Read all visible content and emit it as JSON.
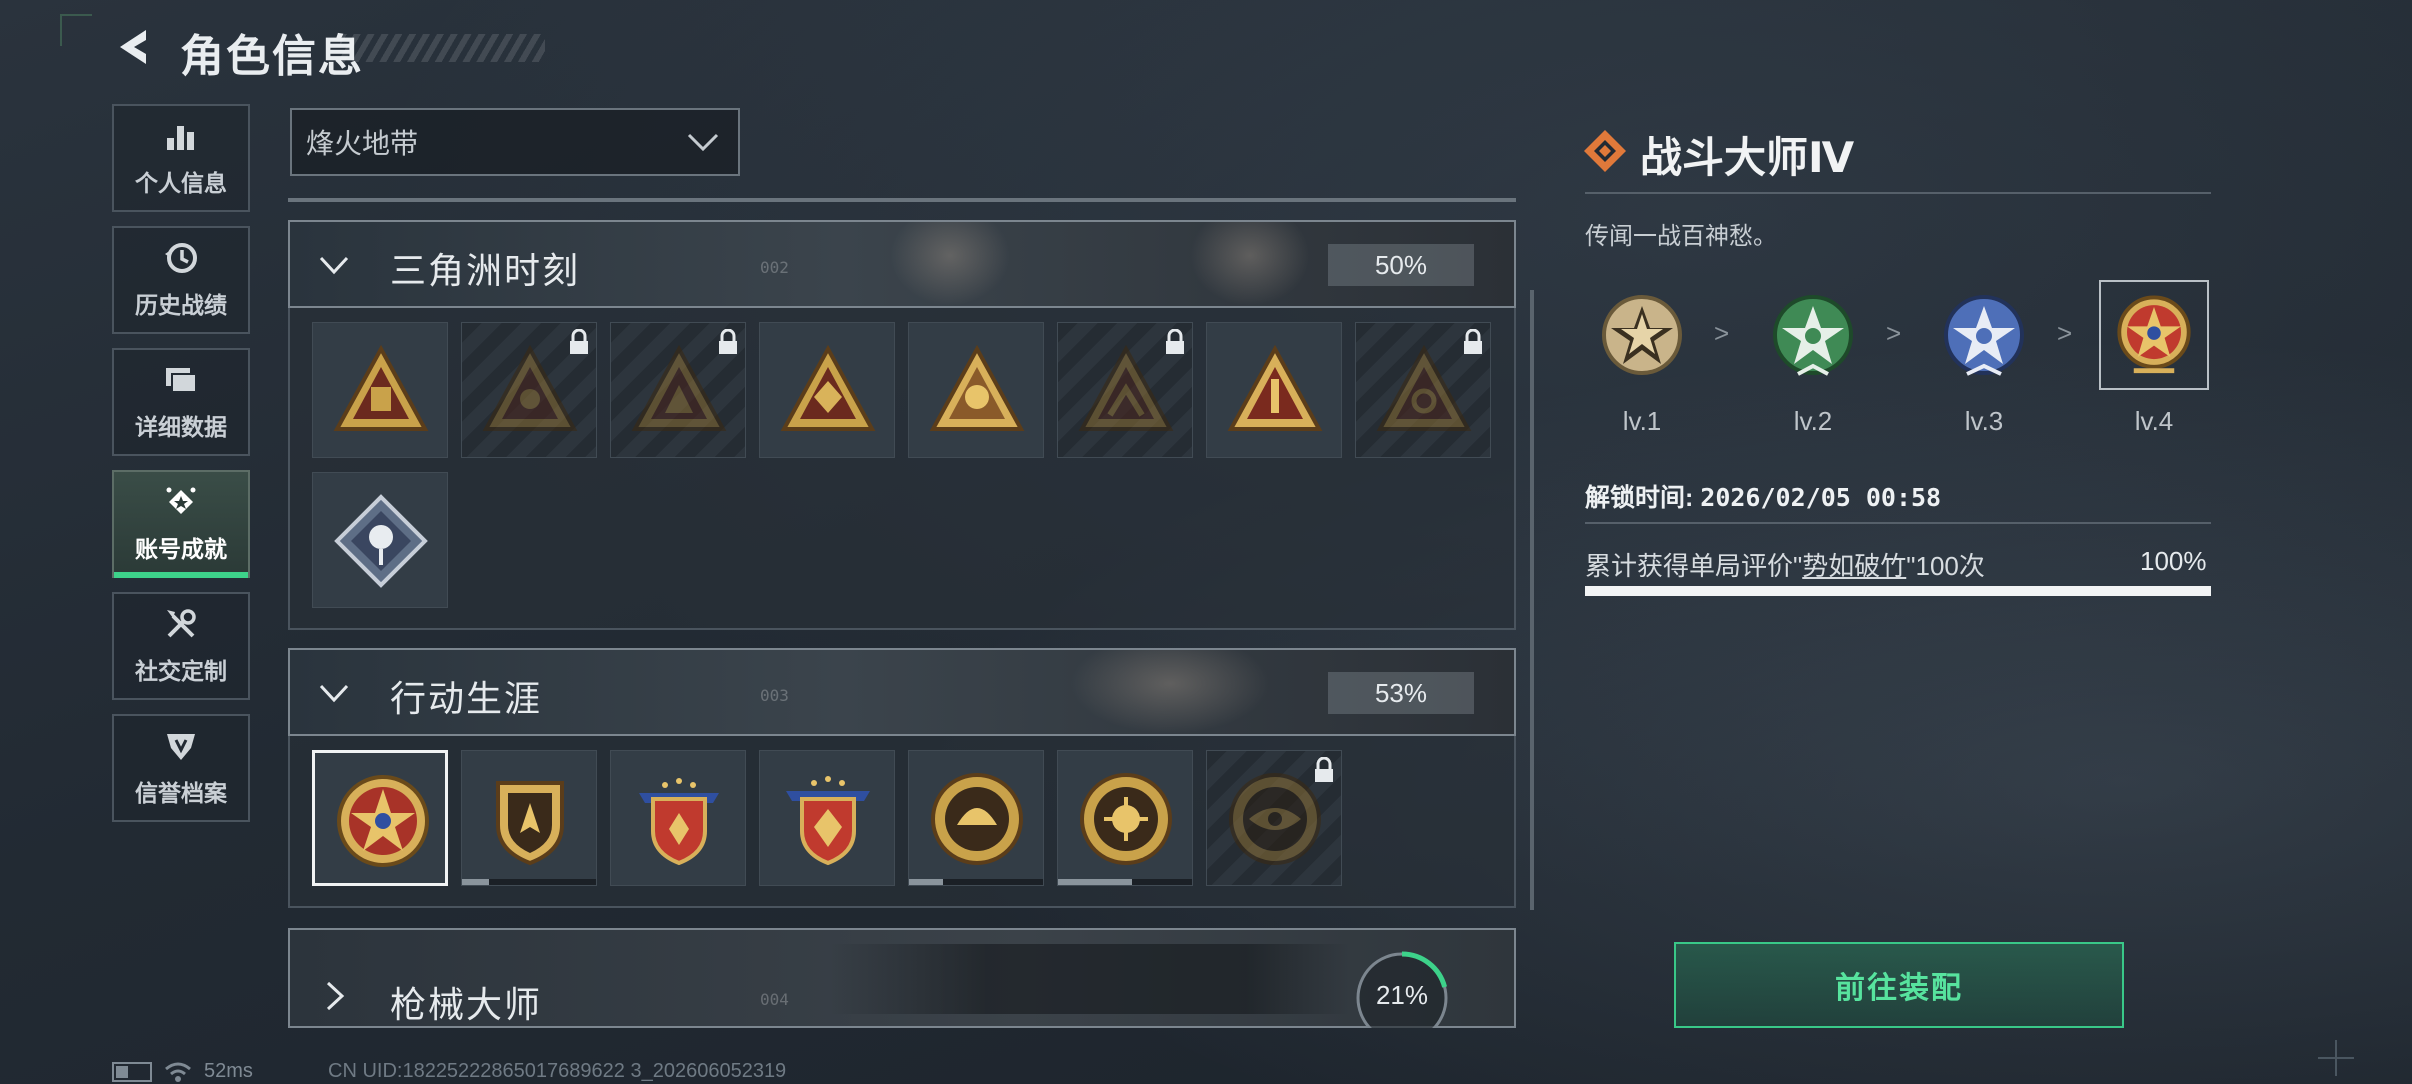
{
  "header": {
    "title": "角色信息"
  },
  "sidebar": {
    "items": [
      {
        "label": "个人信息",
        "icon": "bar-chart-icon",
        "active": false
      },
      {
        "label": "历史战绩",
        "icon": "history-clock-icon",
        "active": false
      },
      {
        "label": "详细数据",
        "icon": "folder-icon",
        "active": false
      },
      {
        "label": "账号成就",
        "icon": "achievement-icon",
        "active": true
      },
      {
        "label": "社交定制",
        "icon": "tools-icon",
        "active": false
      },
      {
        "label": "信誉档案",
        "icon": "shield-emblem-icon",
        "active": false
      }
    ]
  },
  "filter": {
    "selected": "烽火地带"
  },
  "sections": [
    {
      "title": "三角洲时刻",
      "number": "002",
      "percent": "50%",
      "expanded": true,
      "badges": [
        {
          "name": "triangle-badge-1",
          "locked": false
        },
        {
          "name": "triangle-badge-2",
          "locked": true
        },
        {
          "name": "triangle-badge-3",
          "locked": true
        },
        {
          "name": "triangle-badge-4",
          "locked": false
        },
        {
          "name": "triangle-badge-5",
          "locked": false
        },
        {
          "name": "triangle-badge-6",
          "locked": true
        },
        {
          "name": "triangle-badge-7",
          "locked": false
        },
        {
          "name": "triangle-badge-8",
          "locked": true
        },
        {
          "name": "diamond-rose-badge",
          "locked": false
        }
      ]
    },
    {
      "title": "行动生涯",
      "number": "003",
      "percent": "53%",
      "expanded": true,
      "badges": [
        {
          "name": "combat-master-badge",
          "locked": false,
          "selected": true
        },
        {
          "name": "shield-badge",
          "locked": false,
          "progress": 0.2
        },
        {
          "name": "winged-shield-badge",
          "locked": false
        },
        {
          "name": "winged-shield-gold-badge",
          "locked": false
        },
        {
          "name": "round-shell-badge",
          "locked": false,
          "progress": 0.25
        },
        {
          "name": "round-skull-badge",
          "locked": false,
          "progress": 0.55
        },
        {
          "name": "round-eye-badge",
          "locked": true
        }
      ]
    },
    {
      "title": "枪械大师",
      "number": "004",
      "percent": "21%",
      "progress": 0.21,
      "expanded": false
    }
  ],
  "detail": {
    "title": "战斗大师Ⅳ",
    "description": "传闻一战百神愁。",
    "levels": [
      {
        "label": "lv.1",
        "color": "#c9b48a"
      },
      {
        "label": "lv.2",
        "color": "#3f8a55"
      },
      {
        "label": "lv.3",
        "color": "#4e6fb8"
      },
      {
        "label": "lv.4",
        "color": "#c03a2e",
        "selected": true
      }
    ],
    "level_arrow": ">",
    "unlock_label": "解锁时间:",
    "unlock_time": "2026/02/05 00:58",
    "condition_prefix": "累计获得单局评价\"",
    "condition_keyword": "势如破竹",
    "condition_suffix": "\"100次",
    "condition_percent": "100%",
    "condition_progress": 1.0,
    "action_label": "前往装配"
  },
  "status": {
    "ping": "52ms",
    "uid": "CN UID:18225222865017689622 3_202606052319"
  },
  "colors": {
    "accent_green": "#3dd28a",
    "accent_orange": "#e0793a"
  }
}
